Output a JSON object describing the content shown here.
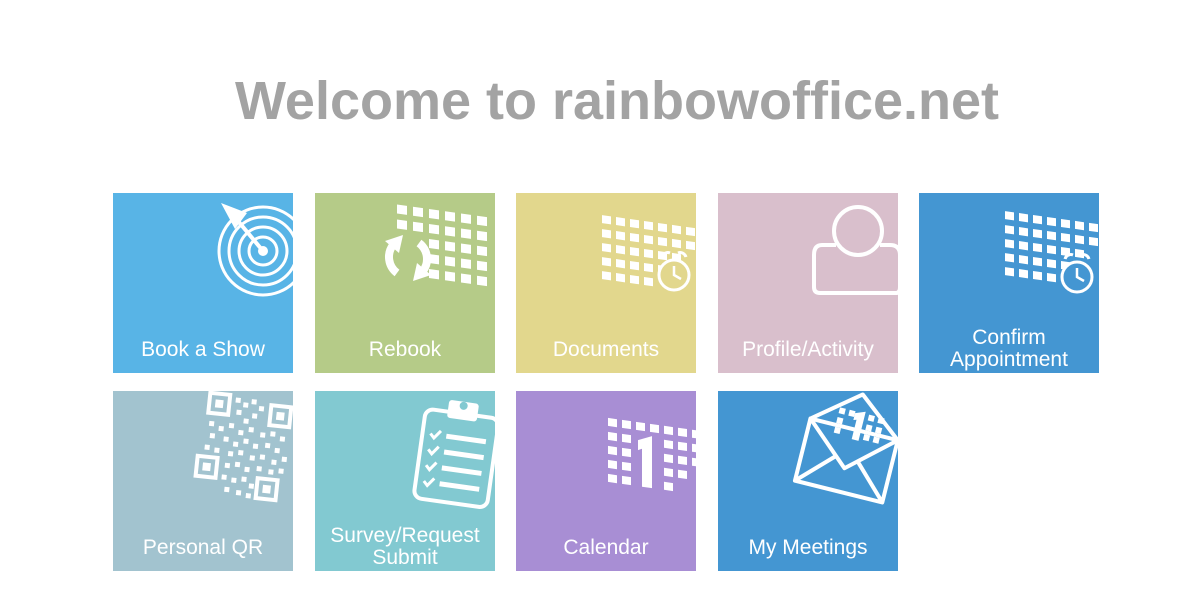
{
  "header": {
    "title": "Welcome to rainbowoffice.net"
  },
  "tiles": [
    {
      "label": "Book a Show",
      "icon": "target-icon",
      "color": "#58b4e6"
    },
    {
      "label": "Rebook",
      "icon": "calendar-refresh-icon",
      "color": "#b5cb88"
    },
    {
      "label": "Documents",
      "icon": "calendar-clock-icon",
      "color": "#e2d78d"
    },
    {
      "label": "Profile/Activity",
      "icon": "user-profile-icon",
      "color": "#d9bfcc"
    },
    {
      "label_line1": "Confirm",
      "label_line2": "Appointment",
      "icon": "calendar-clock-icon",
      "color": "#4496d2"
    },
    {
      "label": "Personal QR",
      "icon": "qr-code-icon",
      "color": "#a2c3cf"
    },
    {
      "label_line1": "Survey/Request",
      "label_line2": "Submit",
      "icon": "clipboard-checklist-icon",
      "color": "#82c9d1"
    },
    {
      "label": "Calendar",
      "icon": "calendar-date-icon",
      "color": "#a88ed4"
    },
    {
      "label": "My Meetings",
      "icon": "envelope-calendar-icon",
      "color": "#4496d2"
    }
  ]
}
